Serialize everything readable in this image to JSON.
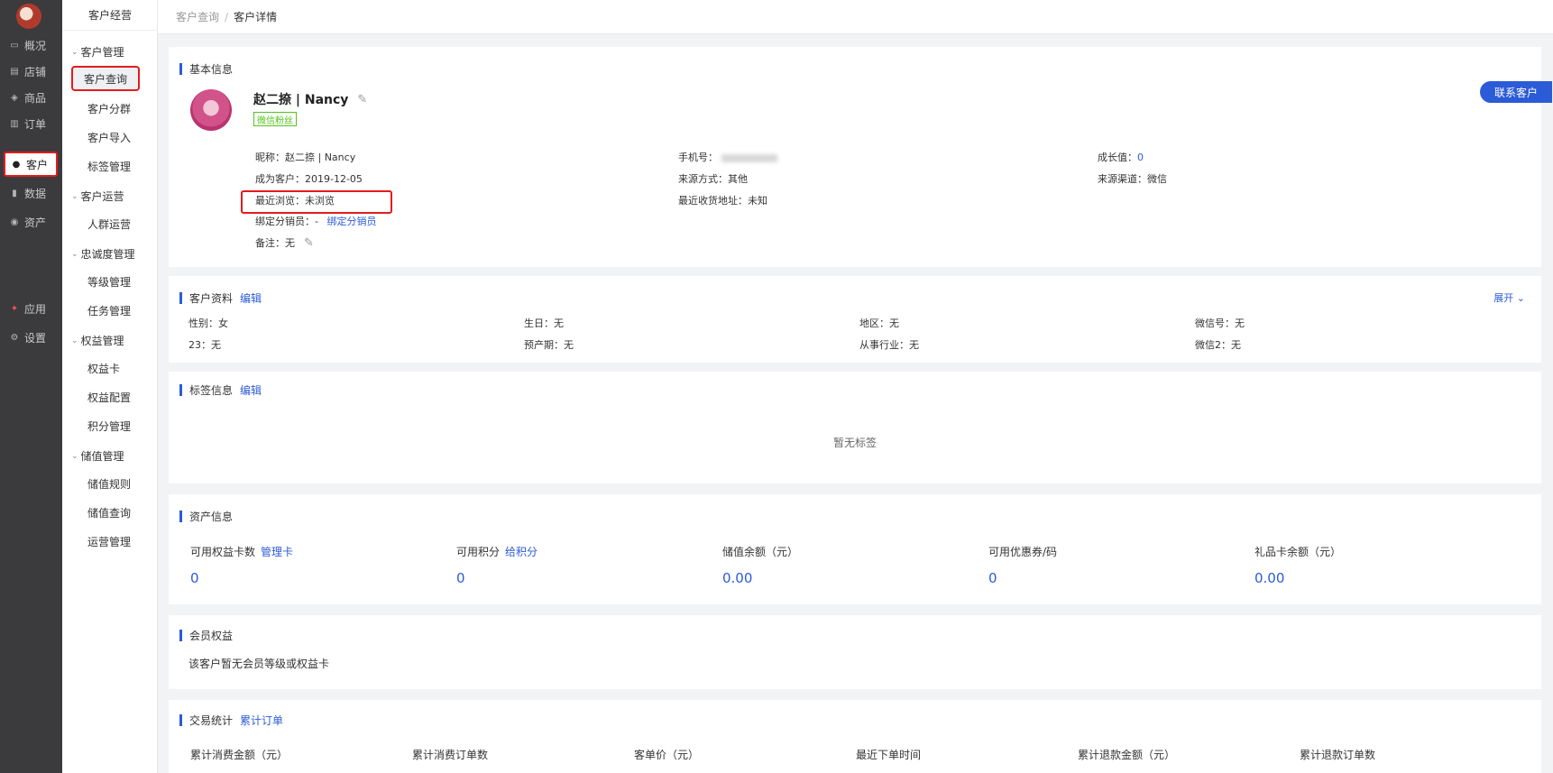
{
  "nav_main": [
    {
      "label": "概况",
      "icon": "monitor-icon",
      "glyph": "▭"
    },
    {
      "label": "店铺",
      "icon": "store-icon",
      "glyph": "▤"
    },
    {
      "label": "商品",
      "icon": "tag-icon",
      "glyph": "◈"
    },
    {
      "label": "订单",
      "icon": "order-icon",
      "glyph": "▥"
    },
    {
      "label": "客户",
      "icon": "user-icon",
      "glyph": "●"
    },
    {
      "label": "数据",
      "icon": "chart-icon",
      "glyph": "▮"
    },
    {
      "label": "资产",
      "icon": "coin-icon",
      "glyph": "◉"
    },
    {
      "label": "应用",
      "icon": "apps-icon",
      "glyph": "✦"
    },
    {
      "label": "设置",
      "icon": "gear-icon",
      "glyph": "⚙"
    }
  ],
  "nav_sub": {
    "title": "客户经营",
    "groups": [
      {
        "label": "客户管理",
        "items": [
          "客户查询",
          "客户分群",
          "客户导入",
          "标签管理"
        ]
      },
      {
        "label": "客户运营",
        "items": [
          "人群运营"
        ]
      },
      {
        "label": "忠诚度管理",
        "items": [
          "等级管理",
          "任务管理"
        ]
      },
      {
        "label": "权益管理",
        "items": [
          "权益卡",
          "权益配置",
          "积分管理"
        ]
      },
      {
        "label": "储值管理",
        "items": [
          "储值规则",
          "储值查询",
          "运营管理"
        ]
      }
    ]
  },
  "breadcrumb": {
    "parent": "客户查询",
    "sep": "/",
    "current": "客户详情"
  },
  "basic": {
    "title": "基本信息",
    "name": "赵二捺 | Nancy",
    "tag": "微信粉丝",
    "contact_btn": "联系客户",
    "nickname_label": "昵称：",
    "nickname": "赵二捺 | Nancy",
    "phone_label": "手机号：",
    "growth_label": "成长值：",
    "growth": "0",
    "since_label": "成为客户：",
    "since": "2019-12-05",
    "source_label": "来源方式：",
    "source": "其他",
    "channel_label": "来源渠道：",
    "channel": "微信",
    "browse_label": "最近浏览：",
    "browse": "未浏览",
    "address_label": "最近收货地址：",
    "address": "未知",
    "distributor_label": "绑定分销员：",
    "distributor": "-",
    "distributor_link": "绑定分销员",
    "remark_label": "备注：",
    "remark": "无"
  },
  "profile": {
    "title": "客户资料",
    "edit": "编辑",
    "expand": "展开 ⌄",
    "rows": [
      [
        "性别：女",
        "生日：无",
        "地区：无",
        "微信号：无"
      ],
      [
        "23：无",
        "预产期：无",
        "从事行业：无",
        "微信2：无"
      ]
    ]
  },
  "tags": {
    "title": "标签信息",
    "edit": "编辑",
    "empty": "暂无标签"
  },
  "assets": {
    "title": "资产信息",
    "items": [
      {
        "label": "可用权益卡数",
        "link": "管理卡",
        "value": "0"
      },
      {
        "label": "可用积分",
        "link": "给积分",
        "value": "0"
      },
      {
        "label": "储值余额（元）",
        "link": "",
        "value": "0.00"
      },
      {
        "label": "可用优惠券/码",
        "link": "",
        "value": "0"
      },
      {
        "label": "礼品卡余额（元）",
        "link": "",
        "value": "0.00"
      }
    ]
  },
  "member": {
    "title": "会员权益",
    "text": "该客户暂无会员等级或权益卡"
  },
  "trade": {
    "title": "交易统计",
    "link": "累计订单",
    "cols": [
      "累计消费金额（元）",
      "累计消费订单数",
      "客单价（元）",
      "最近下单时间",
      "累计退款金额（元）",
      "累计退款订单数"
    ]
  }
}
